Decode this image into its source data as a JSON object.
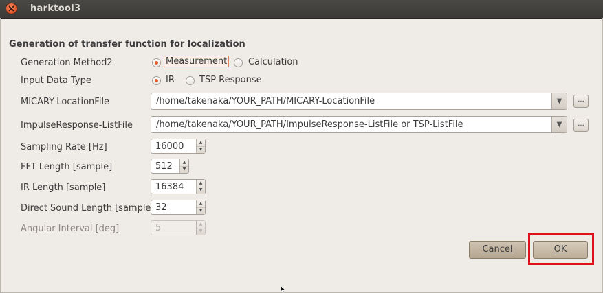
{
  "window": {
    "title": "harktool3"
  },
  "section_title": "Generation of transfer function for localization",
  "generation_method": {
    "label": "Generation Method2",
    "options": [
      "Measurement",
      "Calculation"
    ],
    "selected": "Measurement"
  },
  "input_data_type": {
    "label": "Input Data Type",
    "options": [
      "IR",
      "TSP Response"
    ],
    "selected": "IR"
  },
  "micary_location_file": {
    "label": "MICARY-LocationFile",
    "value": "/home/takenaka/YOUR_PATH/MICARY-LocationFile",
    "browse_label": "..."
  },
  "impulse_response_list_file": {
    "label": "ImpulseResponse-ListFile",
    "value": "/home/takenaka/YOUR_PATH/ImpulseResponse-ListFile or TSP-ListFile",
    "browse_label": "..."
  },
  "sampling_rate": {
    "label": "Sampling Rate [Hz]",
    "value": "16000"
  },
  "fft_length": {
    "label": "FFT Length [sample]",
    "value": "512"
  },
  "ir_length": {
    "label": "IR Length [sample]",
    "value": "16384"
  },
  "direct_sound_length": {
    "label": "Direct Sound Length [sample]",
    "value": "32"
  },
  "angular_interval": {
    "label": "Angular Interval [deg]",
    "value": "5",
    "disabled": true
  },
  "buttons": {
    "cancel": "Cancel",
    "ok": "OK"
  },
  "colors": {
    "accent": "#e45a2d",
    "highlight": "#e0101a",
    "titlebar": "#3c3b37"
  }
}
